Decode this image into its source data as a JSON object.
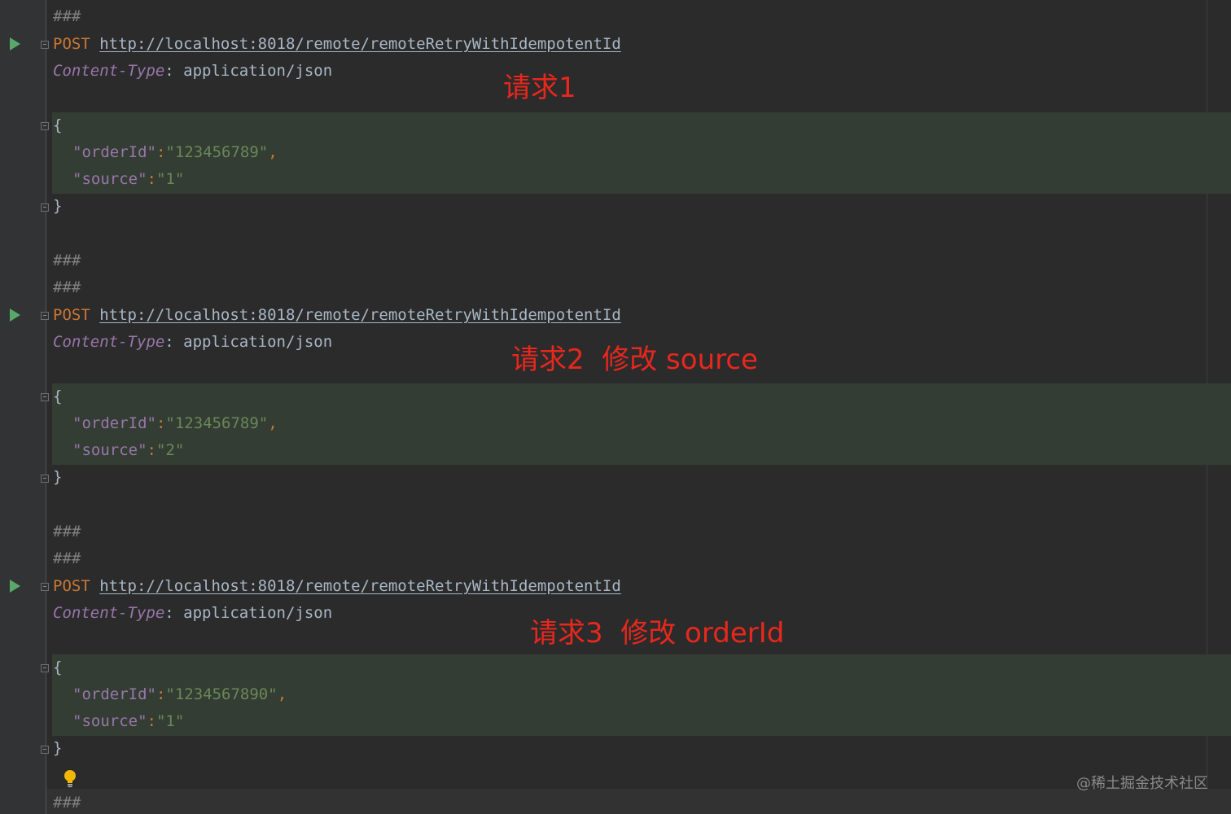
{
  "editor": {
    "separator": "###",
    "brace_open": "{",
    "brace_close": "}",
    "colon_sep": ":",
    "comma": ",",
    "requests": [
      {
        "method": "POST",
        "url": "http://localhost:8018/remote/remoteRetryWithIdempotentId",
        "header_name": "Content-Type",
        "header_value": ": application/json",
        "body": [
          {
            "key": "\"orderId\"",
            "value": "\"123456789\""
          },
          {
            "key": "\"source\"",
            "value": "\"1\""
          }
        ],
        "annotation": "请求1"
      },
      {
        "method": "POST",
        "url": "http://localhost:8018/remote/remoteRetryWithIdempotentId",
        "header_name": "Content-Type",
        "header_value": ": application/json",
        "body": [
          {
            "key": "\"orderId\"",
            "value": "\"123456789\""
          },
          {
            "key": "\"source\"",
            "value": "\"2\""
          }
        ],
        "annotation": "请求2  修改 source"
      },
      {
        "method": "POST",
        "url": "http://localhost:8018/remote/remoteRetryWithIdempotentId",
        "header_name": "Content-Type",
        "header_value": ": application/json",
        "body": [
          {
            "key": "\"orderId\"",
            "value": "\"1234567890\""
          },
          {
            "key": "\"source\"",
            "value": "\"1\""
          }
        ],
        "annotation": "请求3  修改 orderId"
      }
    ]
  },
  "watermark": "@稀土掘金技术社区",
  "colors": {
    "background": "#2b2b2b",
    "json_highlight": "#333d33",
    "annotation_red": "#e8271d",
    "run_green": "#59a869"
  },
  "icons": {
    "run": "run-request-icon",
    "fold": "fold-marker-icon",
    "intention": "lightbulb-icon"
  }
}
